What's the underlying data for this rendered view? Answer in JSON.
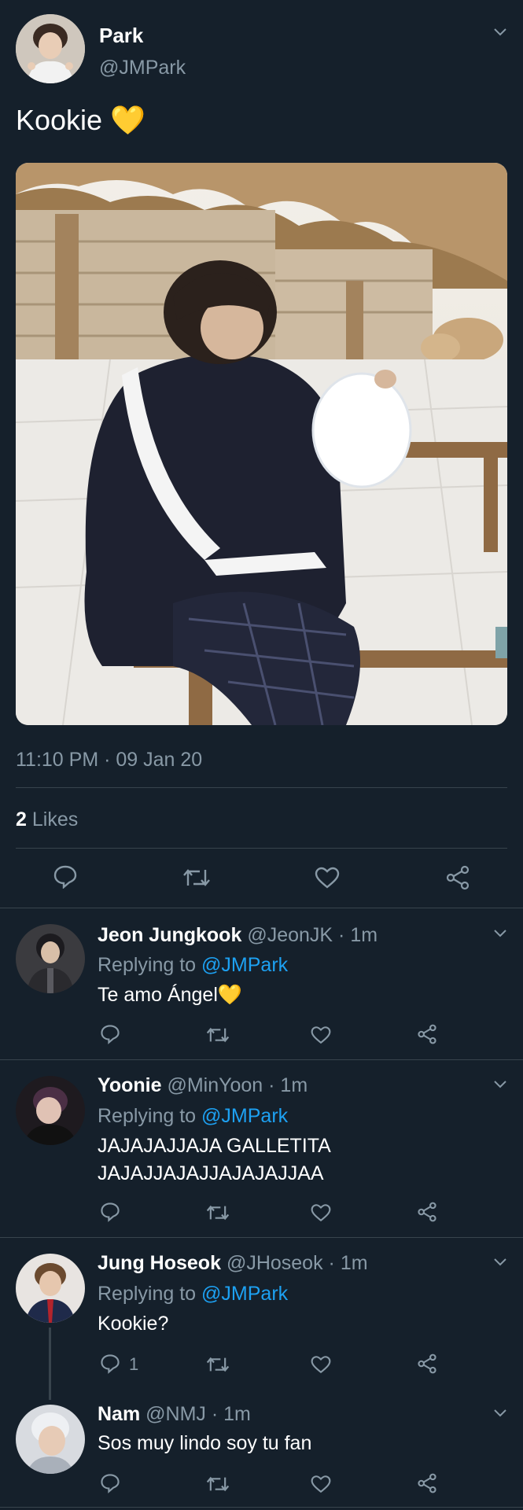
{
  "tweet": {
    "name": "Park",
    "handle": "@JMPark",
    "text": "Kookie 💛",
    "timestamp": "11:10 PM · 09 Jan 20",
    "likes_count": "2",
    "likes_label": "Likes"
  },
  "replies": [
    {
      "name": "Jeon Jungkook",
      "handle": "@JeonJK",
      "time": "· 1m",
      "replying_prefix": "Replying to",
      "replying_to": "@JMPark",
      "text": "Te amo Ángel💛"
    },
    {
      "name": "Yoonie",
      "handle": "@MinYoon",
      "time": "· 1m",
      "replying_prefix": "Replying to",
      "replying_to": "@JMPark",
      "text_line1": "JAJAJAJJAJA GALLETITA",
      "text_line2": "JAJAJJAJAJJAJAJAJJAA"
    },
    {
      "name": "Jung Hoseok",
      "handle": "@JHoseok",
      "time": "· 1m",
      "replying_prefix": "Replying to",
      "replying_to": "@JMPark",
      "text": "Kookie?",
      "reply_count": "1"
    },
    {
      "name": "Nam",
      "handle": "@NMJ",
      "time": "· 1m",
      "text": "Sos muy lindo soy tu fan"
    }
  ],
  "colors": {
    "background": "#15202b",
    "divider": "#38444d",
    "muted": "#8899a6",
    "link": "#1da1f2"
  }
}
